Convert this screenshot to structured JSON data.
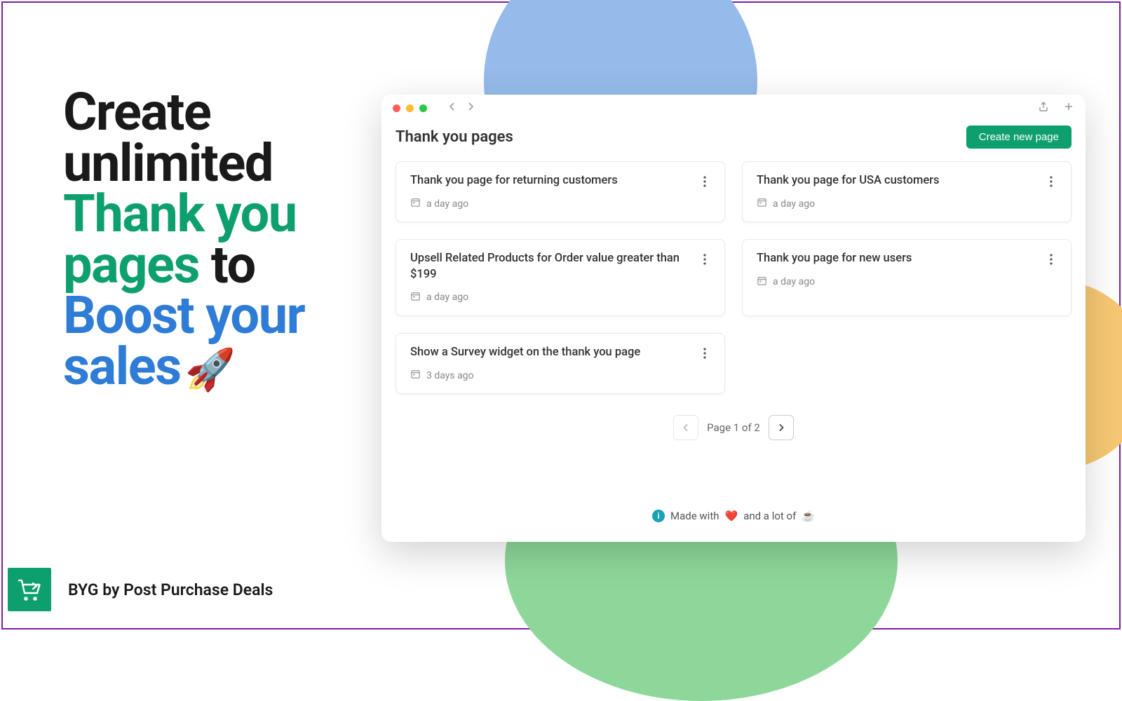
{
  "hero": {
    "line1": "Create unlimited ",
    "line2": "Thank you pages",
    "line3": " to ",
    "line4": "Boost your sales",
    "rocket": "🚀"
  },
  "brand": {
    "label": "BYG by Post Purchase Deals"
  },
  "window": {
    "title": "Thank you pages",
    "create_label": "Create new page",
    "cards": [
      {
        "title": "Thank you page for returning customers",
        "time": "a day ago"
      },
      {
        "title": "Thank you page for USA customers",
        "time": "a day ago"
      },
      {
        "title": "Upsell Related Products for Order value greater than $199",
        "time": "a day ago"
      },
      {
        "title": "Thank you page for new users",
        "time": "a day ago"
      },
      {
        "title": "Show a Survey widget on the thank you page",
        "time": "3 days ago"
      }
    ],
    "pagination": "Page 1 of 2",
    "footer_prefix": "Made with",
    "footer_heart": "❤️",
    "footer_mid": "and a lot of",
    "footer_coffee": "☕"
  }
}
